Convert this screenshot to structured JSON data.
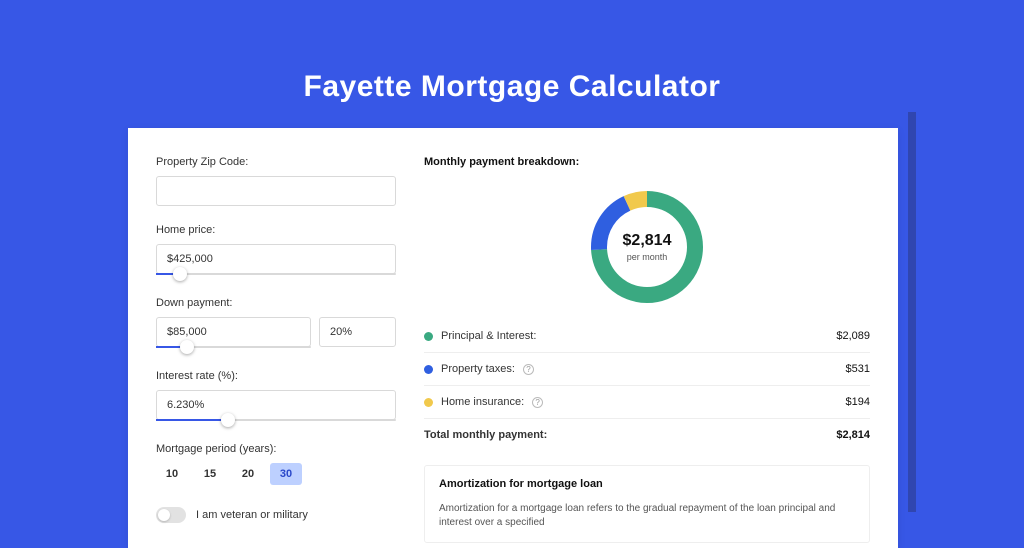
{
  "title": "Fayette Mortgage Calculator",
  "form": {
    "zip": {
      "label": "Property Zip Code:",
      "value": ""
    },
    "price": {
      "label": "Home price:",
      "value": "$425,000",
      "slider_pct": 10
    },
    "down": {
      "label": "Down payment:",
      "amount": "$85,000",
      "pct": "20%",
      "slider_pct": 20
    },
    "rate": {
      "label": "Interest rate (%):",
      "value": "6.230%",
      "slider_pct": 30
    },
    "period": {
      "label": "Mortgage period (years):",
      "options": [
        "10",
        "15",
        "20",
        "30"
      ],
      "selected": "30"
    },
    "veteran": {
      "label": "I am veteran or military",
      "value": false
    }
  },
  "breakdown": {
    "title": "Monthly payment breakdown:",
    "total_value": "$2,814",
    "total_sub": "per month",
    "items": [
      {
        "label": "Principal & Interest:",
        "amount": "$2,089",
        "color": "#3aa981",
        "help": false,
        "pct": 74
      },
      {
        "label": "Property taxes:",
        "amount": "$531",
        "color": "#2f5fe0",
        "help": true,
        "pct": 19
      },
      {
        "label": "Home insurance:",
        "amount": "$194",
        "color": "#f1c94c",
        "help": true,
        "pct": 7
      }
    ],
    "total_row": {
      "label": "Total monthly payment:",
      "amount": "$2,814"
    }
  },
  "amort": {
    "title": "Amortization for mortgage loan",
    "text": "Amortization for a mortgage loan refers to the gradual repayment of the loan principal and interest over a specified"
  },
  "chart_data": {
    "type": "pie",
    "title": "Monthly payment breakdown",
    "categories": [
      "Principal & Interest",
      "Property taxes",
      "Home insurance"
    ],
    "values": [
      2089,
      531,
      194
    ],
    "total": 2814,
    "unit": "$ per month",
    "colors": [
      "#3aa981",
      "#2f5fe0",
      "#f1c94c"
    ]
  }
}
